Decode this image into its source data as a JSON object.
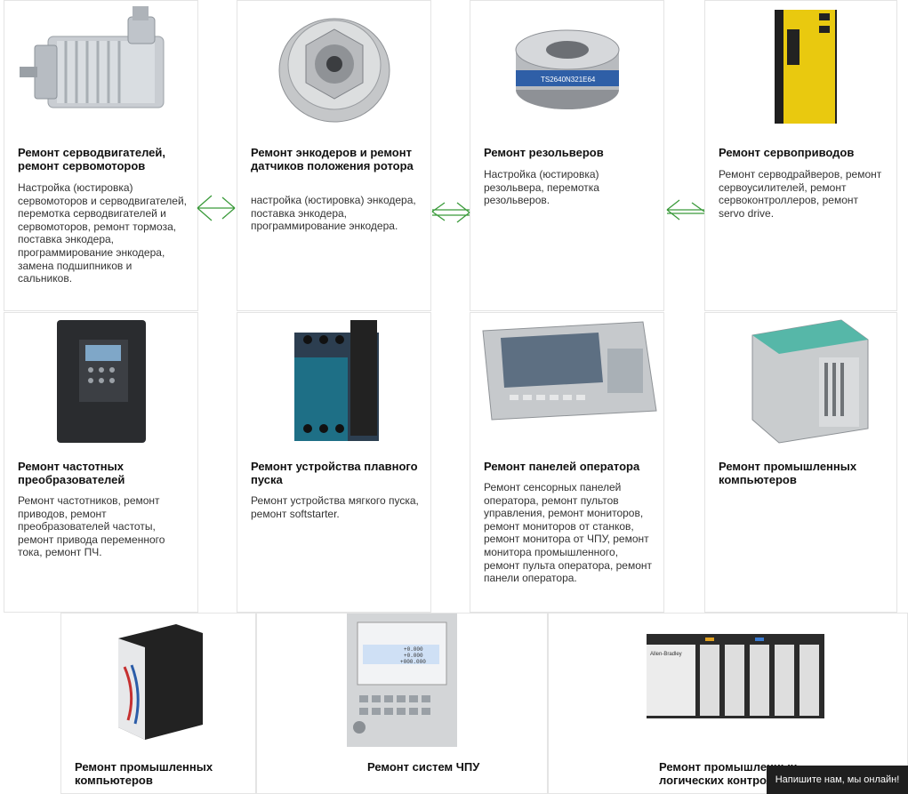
{
  "cards": [
    {
      "title": "Ремонт серводвигателей, ремонт сервомоторов",
      "desc": "Настройка (юстировка) сервомоторов и серводвигателей, перемотка серводвигателей и сервомоторов, ремонт тормоза, поставка энкодера, программирование энкодера, замена подшипников и сальников.",
      "image": "servo-motor-photo"
    },
    {
      "title": "Ремонт энкодеров и ремонт датчиков положения ротора",
      "desc": "настройка (юстировка) энкодера, поставка энкодера, программирование энкодера.",
      "image": "encoder-photo"
    },
    {
      "title": "Ремонт резольверов",
      "desc": "Настройка (юстировка) резольвера, перемотка резольверов.",
      "image": "resolver-photo"
    },
    {
      "title": "Ремонт сервоприводов",
      "desc": "Ремонт серводрайверов, ремонт сервоусилителей, ремонт сервоконтроллеров, ремонт servo drive.",
      "image": "servo-drive-photo"
    },
    {
      "title": "Ремонт частотных преобразователей",
      "desc": "Ремонт частотников, ремонт приводов, ремонт преобразователей частоты, ремонт привода переменного тока, ремонт ПЧ.",
      "image": "frequency-converter-photo"
    },
    {
      "title": "Ремонт устройства плавного пуска",
      "desc": "Ремонт устройства мягкого пуска, ремонт softstarter.",
      "image": "soft-starter-photo"
    },
    {
      "title": "Ремонт панелей оператора",
      "desc": "Ремонт сенсорных панелей оператора, ремонт пультов управления, ремонт мониторов, ремонт мониторов от станков, ремонт монитора от ЧПУ, ремонт монитора промышленного, ремонт пульта оператора, ремонт панели оператора.",
      "image": "operator-panel-photo"
    },
    {
      "title": "Ремонт промышленных компьютеров",
      "desc": "",
      "image": "industrial-pc-photo"
    },
    {
      "title": "Ремонт промышленных компьютеров",
      "desc": "",
      "image": "industrial-pc-box-photo"
    },
    {
      "title": "Ремонт систем ЧПУ",
      "desc": "",
      "image": "cnc-system-photo"
    },
    {
      "title": "Ремонт промышленных логических контроллеров",
      "desc": "",
      "image": "plc-photo"
    }
  ],
  "cnc_screen": {
    "v1": "+0.000",
    "v2": "+0.000",
    "v3": "+000.000"
  },
  "plc_brand": "Allen-Bradley",
  "encoder_label": "TS2640N321E64",
  "chat": {
    "label": "Напишите нам, мы онлайн!"
  },
  "colors": {
    "arrow": "#3a9a3a",
    "card_border": "#e4e4e4",
    "chat_bg": "#1f1f1f"
  }
}
